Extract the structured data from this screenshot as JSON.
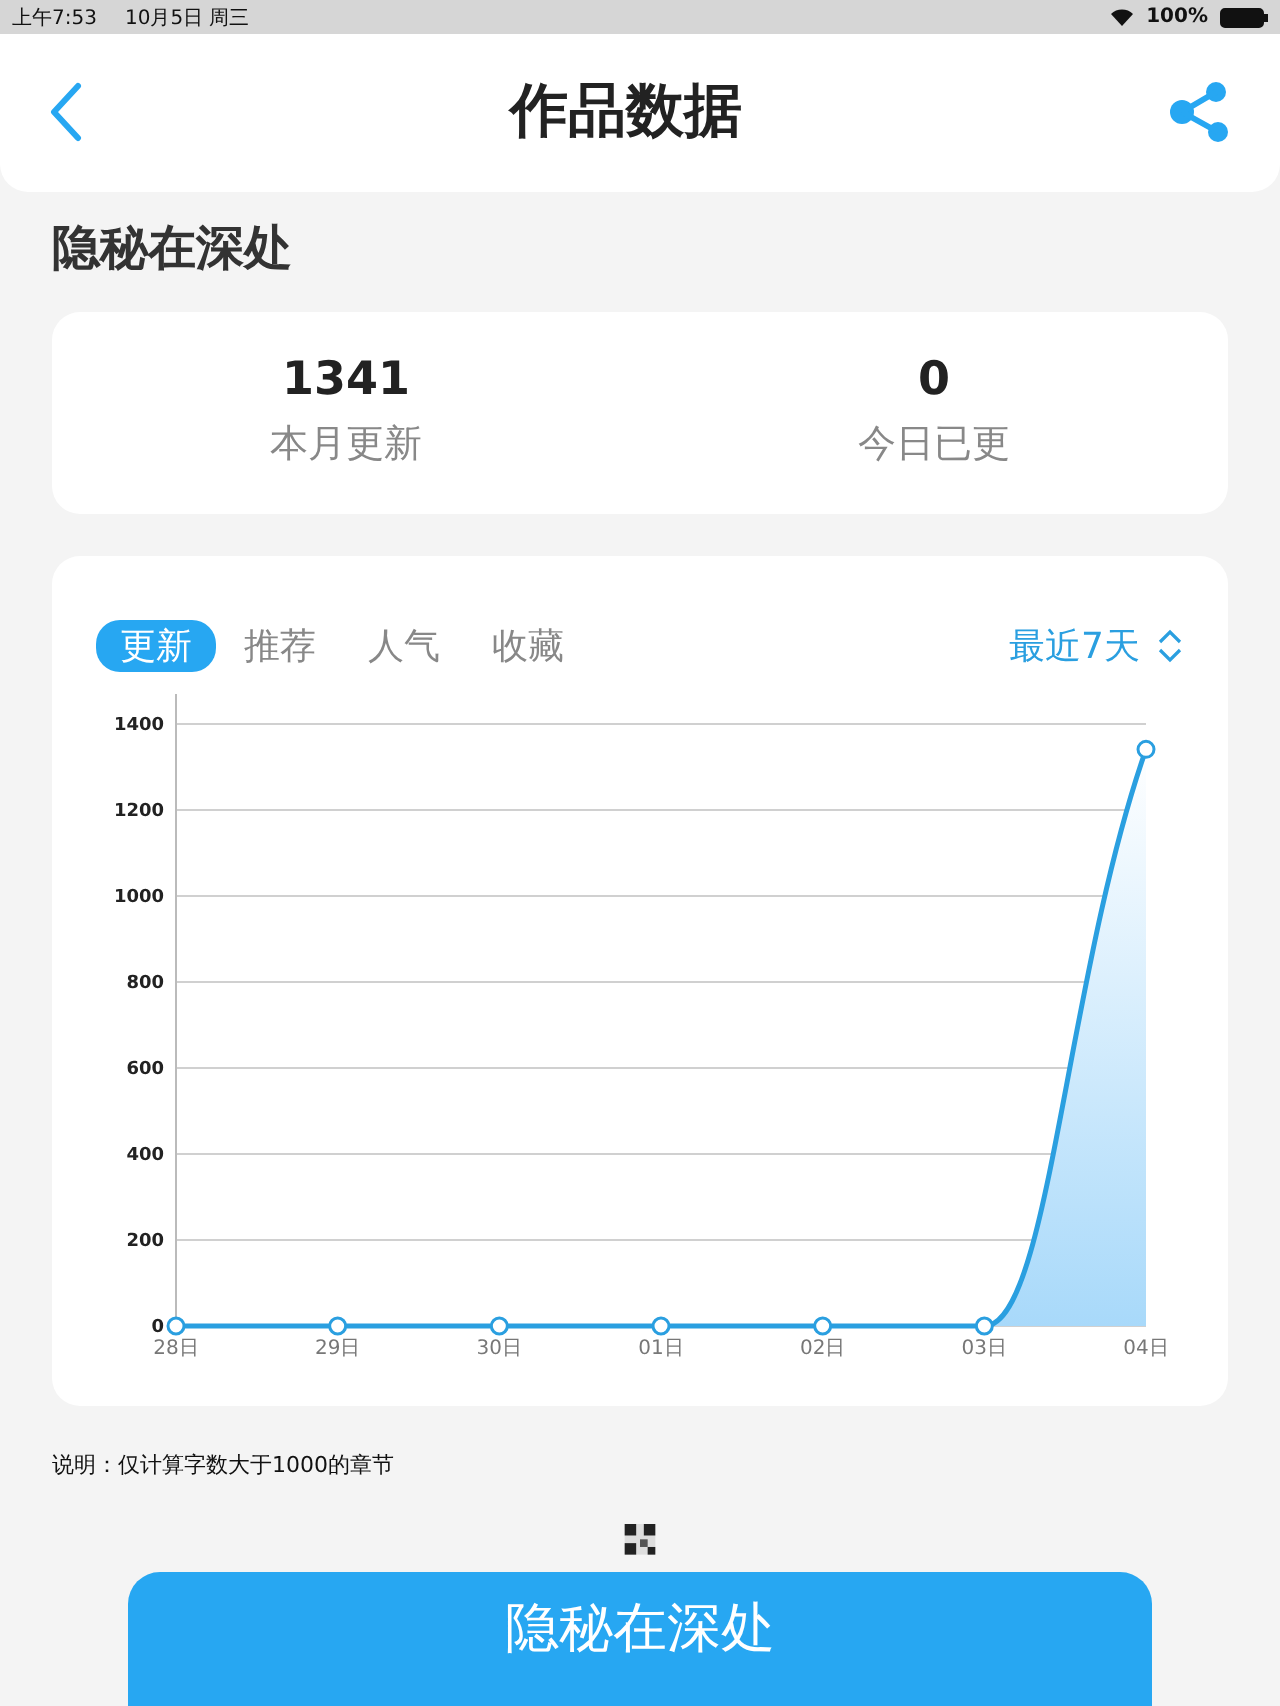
{
  "status_bar": {
    "time": "上午7:53",
    "date": "10月5日 周三",
    "battery": "100%"
  },
  "header": {
    "title": "作品数据"
  },
  "work_title": "隐秘在深处",
  "stats": [
    {
      "value": "1341",
      "label": "本月更新"
    },
    {
      "value": "0",
      "label": "今日已更"
    }
  ],
  "tabs": [
    {
      "label": "更新",
      "selected": true
    },
    {
      "label": "推荐",
      "selected": false
    },
    {
      "label": "人气",
      "selected": false
    },
    {
      "label": "收藏",
      "selected": false
    }
  ],
  "range": "最近7天",
  "chart_data": {
    "type": "area",
    "categories": [
      "28日",
      "29日",
      "30日",
      "01日",
      "02日",
      "03日",
      "04日"
    ],
    "grid": true,
    "series": [
      {
        "color": "#2a9fe0",
        "values": [
          0,
          0,
          0,
          0,
          0,
          0,
          1341
        ]
      }
    ],
    "ylim": [
      0,
      1470
    ],
    "yticks": [
      0,
      200,
      400,
      600,
      800,
      1000,
      1200,
      1400
    ]
  },
  "note": "说明：仅计算字数大于1000的章节",
  "button": "隐秘在深处"
}
